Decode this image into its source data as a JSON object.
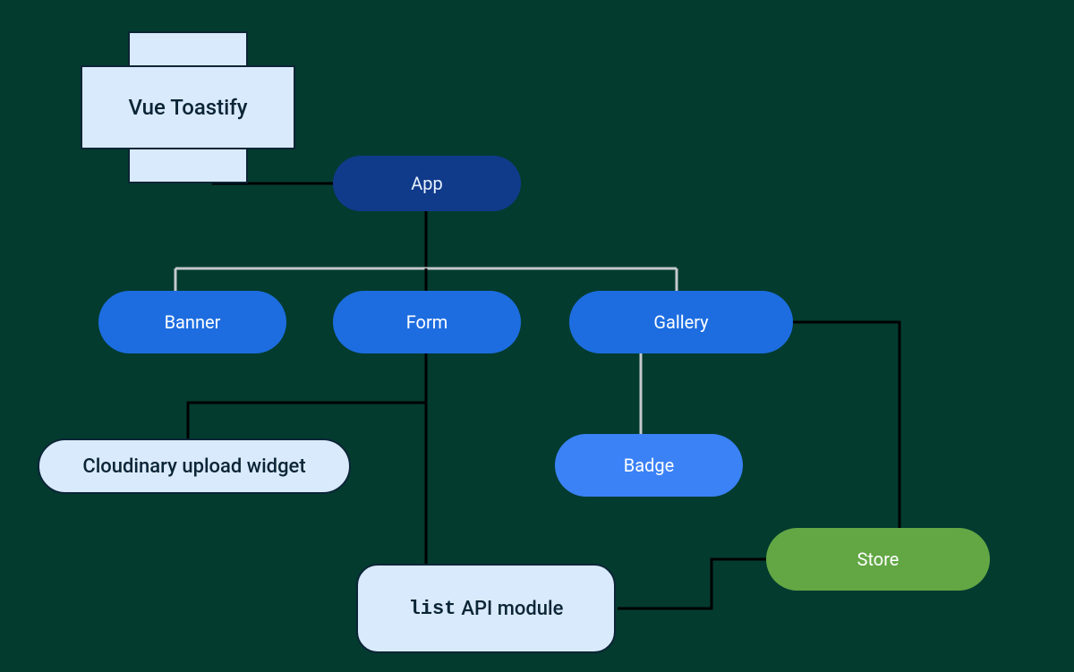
{
  "nodes": {
    "vue_toastify": {
      "label": "Vue Toastify"
    },
    "app": {
      "label": "App"
    },
    "banner": {
      "label": "Banner"
    },
    "form": {
      "label": "Form"
    },
    "gallery": {
      "label": "Gallery"
    },
    "cloudinary": {
      "label": "Cloudinary upload widget"
    },
    "badge": {
      "label": "Badge"
    },
    "list_api": {
      "code": "list",
      "label_rest": "API module"
    },
    "store": {
      "label": "Store"
    }
  },
  "edges": [
    {
      "from": "vue_toastify",
      "to": "app",
      "style": "black"
    },
    {
      "from": "app",
      "to": "banner",
      "style": "gray"
    },
    {
      "from": "app",
      "to": "form",
      "style": "black"
    },
    {
      "from": "app",
      "to": "gallery",
      "style": "gray"
    },
    {
      "from": "form",
      "to": "cloudinary",
      "style": "black"
    },
    {
      "from": "form",
      "to": "list_api",
      "style": "black"
    },
    {
      "from": "gallery",
      "to": "badge",
      "style": "gray"
    },
    {
      "from": "gallery",
      "to": "store",
      "style": "black"
    },
    {
      "from": "list_api",
      "to": "store",
      "style": "black"
    }
  ],
  "colors": {
    "bg": "#033b2f",
    "blue": "#1d6de0",
    "blue_light": "#3b82f6",
    "blue_dark": "#103a8a",
    "pale": "#d9eafc",
    "outline": "#0b2536",
    "green": "#62a744",
    "edge_black": "#000000",
    "edge_gray": "#c5c9cc"
  }
}
